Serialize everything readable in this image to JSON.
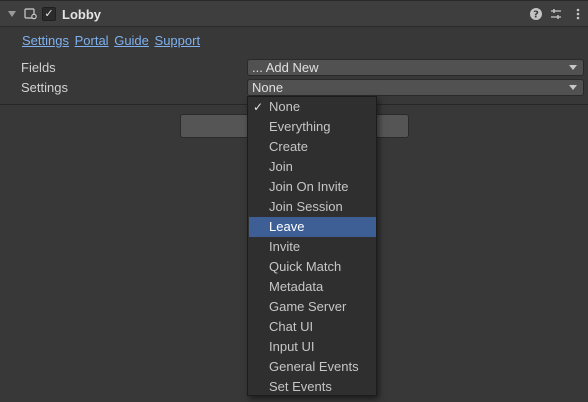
{
  "component": {
    "title": "Lobby",
    "enabled_check": "✓"
  },
  "links": [
    "Settings",
    "Portal",
    "Guide",
    "Support"
  ],
  "fields": {
    "fields_label": "Fields",
    "fields_value": "... Add New",
    "settings_label": "Settings",
    "settings_value": "None"
  },
  "menu": {
    "items": [
      "None",
      "Everything",
      "Create",
      "Join",
      "Join On Invite",
      "Join Session",
      "Leave",
      "Invite",
      "Quick Match",
      "Metadata",
      "Game Server",
      "Chat UI",
      "Input UI",
      "General Events",
      "Set Events"
    ],
    "checked_item": "None",
    "highlighted_item": "Leave",
    "check_glyph": "✓"
  },
  "colors": {
    "link": "#7fb1ee",
    "highlight": "#3e5f96",
    "background": "#383838"
  }
}
